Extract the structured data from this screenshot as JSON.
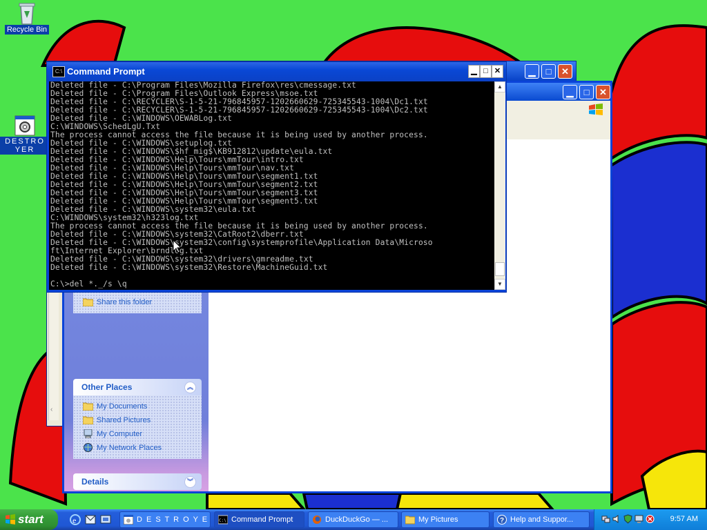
{
  "desktop": {
    "icons": [
      {
        "label": "Recycle Bin"
      },
      {
        "label": "DESTROYER"
      }
    ]
  },
  "command_prompt": {
    "title": "Command Prompt",
    "lines": [
      "Deleted file - C:\\Program Files\\Mozilla Firefox\\res\\cmessage.txt",
      "Deleted file - C:\\Program Files\\Outlook Express\\msoe.txt",
      "Deleted file - C:\\RECYCLER\\S-1-5-21-796845957-1202660629-725345543-1004\\Dc1.txt",
      "Deleted file - C:\\RECYCLER\\S-1-5-21-796845957-1202660629-725345543-1004\\Dc2.txt",
      "Deleted file - C:\\WINDOWS\\OEWABLog.txt",
      "C:\\WINDOWS\\SchedLgU.Txt",
      "The process cannot access the file because it is being used by another process.",
      "Deleted file - C:\\WINDOWS\\setuplog.txt",
      "Deleted file - C:\\WINDOWS\\$hf_mig$\\KB912812\\update\\eula.txt",
      "Deleted file - C:\\WINDOWS\\Help\\Tours\\mmTour\\intro.txt",
      "Deleted file - C:\\WINDOWS\\Help\\Tours\\mmTour\\nav.txt",
      "Deleted file - C:\\WINDOWS\\Help\\Tours\\mmTour\\segment1.txt",
      "Deleted file - C:\\WINDOWS\\Help\\Tours\\mmTour\\segment2.txt",
      "Deleted file - C:\\WINDOWS\\Help\\Tours\\mmTour\\segment3.txt",
      "Deleted file - C:\\WINDOWS\\Help\\Tours\\mmTour\\segment5.txt",
      "Deleted file - C:\\WINDOWS\\system32\\eula.txt",
      "C:\\WINDOWS\\system32\\h323log.txt",
      "The process cannot access the file because it is being used by another process.",
      "Deleted file - C:\\WINDOWS\\system32\\CatRoot2\\dberr.txt",
      "Deleted file - C:\\WINDOWS\\system32\\config\\systemprofile\\Application Data\\Microso",
      "ft\\Internet Explorer\\brndlog.txt",
      "Deleted file - C:\\WINDOWS\\system32\\drivers\\gmreadme.txt",
      "Deleted file - C:\\WINDOWS\\system32\\Restore\\MachineGuid.txt",
      "",
      "C:\\>del *._/s \\q"
    ]
  },
  "explorer": {
    "file_tasks_visible_item": "Share this folder",
    "other_places": {
      "title": "Other Places",
      "items": [
        "My Documents",
        "Shared Pictures",
        "My Computer",
        "My Network Places"
      ]
    },
    "details": {
      "title": "Details"
    },
    "scroll_glyph": "‹"
  },
  "taskbar": {
    "start_label": "start",
    "tasks": [
      {
        "label": "D E S T R O Y E ..."
      },
      {
        "label": "Command Prompt"
      },
      {
        "label": "DuckDuckGo — ..."
      },
      {
        "label": "My Pictures"
      },
      {
        "label": "Help and Suppor..."
      }
    ],
    "clock": "9:57 AM"
  },
  "colors": {
    "desktop_green": "#4be34b",
    "taskbar_blue": "#245edb",
    "start_green": "#37a03a",
    "window_blue": "#0a43d8"
  }
}
